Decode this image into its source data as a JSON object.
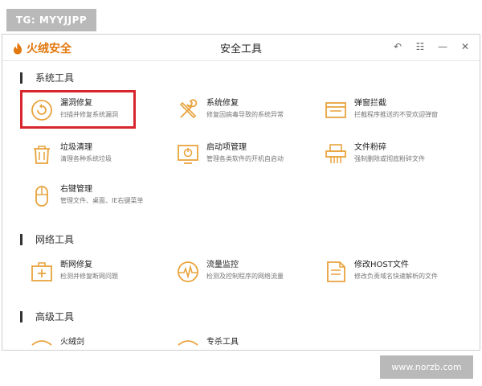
{
  "watermark_top": "TG: MYYJJPP",
  "watermark_bottom": "www.norzb.com",
  "app": {
    "logo_text": "火绒安全",
    "window_title": "安全工具"
  },
  "colors": {
    "accent": "#e8a33c",
    "brand": "#e2780e",
    "highlight": "#d7262d"
  },
  "icons": {
    "restore": "↶",
    "menu": "☷",
    "minimize": "—",
    "close": "✕"
  },
  "sections": {
    "system": "系统工具",
    "network": "网络工具",
    "advanced": "高级工具"
  },
  "items": {
    "vuln": {
      "title": "漏洞修复",
      "desc": "扫描并修复系统漏洞"
    },
    "sysfix": {
      "title": "系统修复",
      "desc": "修复因病毒导致的系统异常"
    },
    "popup": {
      "title": "弹窗拦截",
      "desc": "拦截程序推送的不受欢迎弹窗"
    },
    "junk": {
      "title": "垃圾清理",
      "desc": "清理各种系统垃圾"
    },
    "startup": {
      "title": "启动项管理",
      "desc": "管理各类软件的开机自启动"
    },
    "shred": {
      "title": "文件粉碎",
      "desc": "强制删除或彻底粉碎文件"
    },
    "rclick": {
      "title": "右键管理",
      "desc": "管理文件、桌面、IE右键菜单"
    },
    "netrepair": {
      "title": "断网修复",
      "desc": "检测并修复断网问题"
    },
    "traffic": {
      "title": "流量监控",
      "desc": "检测及控制程序的网络流量"
    },
    "hosts": {
      "title": "修改HOST文件",
      "desc": "修改负责域名快速解析的文件"
    },
    "adv1": {
      "title": "火绒剑"
    },
    "adv2": {
      "title": "专杀工具"
    }
  }
}
